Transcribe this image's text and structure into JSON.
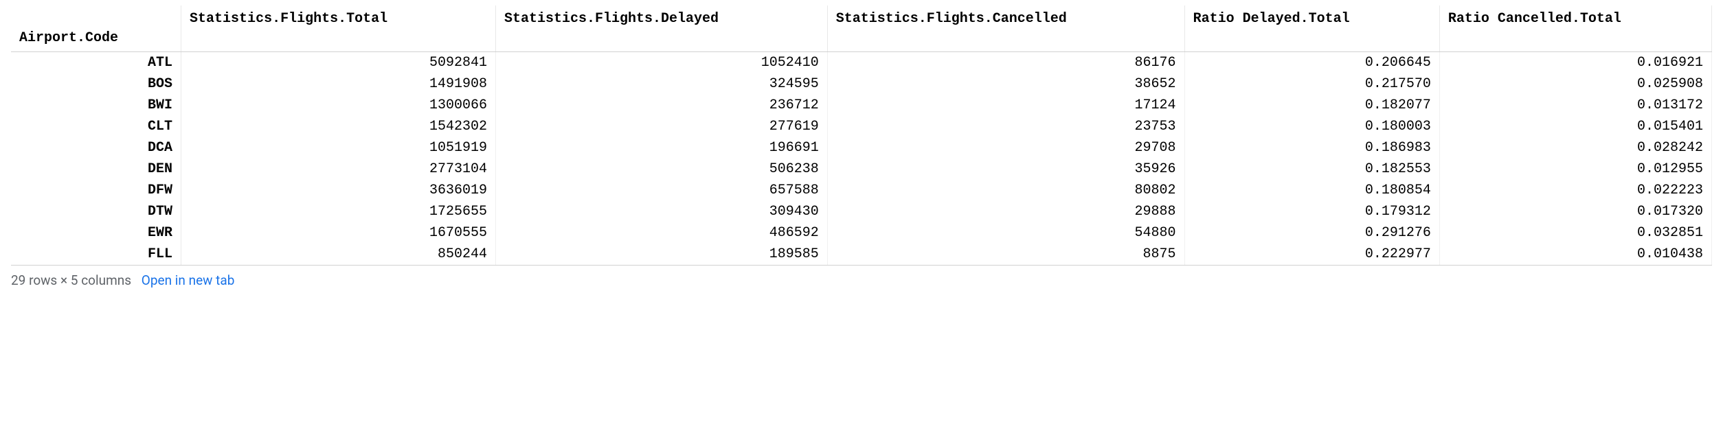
{
  "table": {
    "index_label": "Airport.Code",
    "columns": [
      "Statistics.Flights.Total",
      "Statistics.Flights.Delayed",
      "Statistics.Flights.Cancelled",
      "Ratio Delayed.Total",
      "Ratio Cancelled.Total"
    ],
    "rows": [
      {
        "index": "ATL",
        "cells": [
          "5092841",
          "1052410",
          "86176",
          "0.206645",
          "0.016921"
        ]
      },
      {
        "index": "BOS",
        "cells": [
          "1491908",
          "324595",
          "38652",
          "0.217570",
          "0.025908"
        ]
      },
      {
        "index": "BWI",
        "cells": [
          "1300066",
          "236712",
          "17124",
          "0.182077",
          "0.013172"
        ]
      },
      {
        "index": "CLT",
        "cells": [
          "1542302",
          "277619",
          "23753",
          "0.180003",
          "0.015401"
        ]
      },
      {
        "index": "DCA",
        "cells": [
          "1051919",
          "196691",
          "29708",
          "0.186983",
          "0.028242"
        ]
      },
      {
        "index": "DEN",
        "cells": [
          "2773104",
          "506238",
          "35926",
          "0.182553",
          "0.012955"
        ]
      },
      {
        "index": "DFW",
        "cells": [
          "3636019",
          "657588",
          "80802",
          "0.180854",
          "0.022223"
        ]
      },
      {
        "index": "DTW",
        "cells": [
          "1725655",
          "309430",
          "29888",
          "0.179312",
          "0.017320"
        ]
      },
      {
        "index": "EWR",
        "cells": [
          "1670555",
          "486592",
          "54880",
          "0.291276",
          "0.032851"
        ]
      },
      {
        "index": "FLL",
        "cells": [
          "850244",
          "189585",
          "8875",
          "0.222977",
          "0.010438"
        ]
      }
    ]
  },
  "footer": {
    "shape_text": "29 rows × 5 columns",
    "link_text": "Open in new tab"
  }
}
